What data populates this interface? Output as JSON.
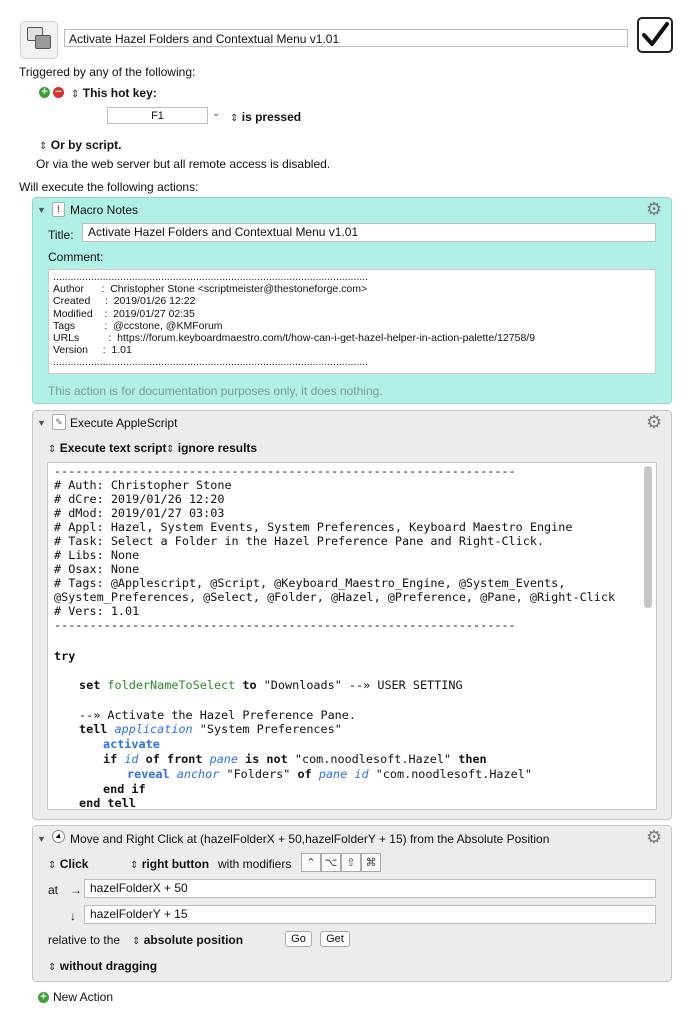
{
  "macro": {
    "name": "Activate Hazel Folders and Contextual Menu v1.01"
  },
  "triggers": {
    "heading": "Triggered by any of the following:",
    "hotkey_label": "This hot key:",
    "hotkey_value": "F1",
    "hotkey_state": "is pressed",
    "script_label": "Or by script.",
    "web_server_text": "Or via the web server but all remote access is disabled."
  },
  "actions_heading": "Will execute the following actions:",
  "notes_action": {
    "title": "Macro Notes",
    "title_label": "Title:",
    "title_value": "Activate Hazel Folders and Contextual Menu v1.01",
    "comment_label": "Comment:",
    "comment_text": "............................................................................................................\nAuthor      :  Christopher Stone <scriptmeister@thestoneforge.com>\nCreated     :  2019/01/26 12:22\nModified    :  2019/01/27 02:35\nTags          :  @ccstone, @KMForum\nURLs          :  https://forum.keyboardmaestro.com/t/how-can-i-get-hazel-helper-in-action-palette/12758/9\nVersion     :  1.01\n............................................................................................................",
    "footer": "This action is for documentation purposes only, it does nothing."
  },
  "applescript_action": {
    "title": "Execute AppleScript",
    "mode": "Execute text script",
    "results": "ignore results",
    "lines": [
      "-----------------------------------------------------------------",
      "# Auth: Christopher Stone",
      "# dCre: 2019/01/26 12:20",
      "# dMod: 2019/01/27 03:03",
      "# Appl: Hazel, System Events, System Preferences, Keyboard Maestro Engine",
      "# Task: Select a Folder in the Hazel Preference Pane and Right-Click.",
      "# Libs: None",
      "# Osax: None",
      "# Tags: @Applescript, @Script, @Keyboard_Maestro_Engine, @System_Events,",
      "@System_Preferences, @Select, @Folder, @Hazel, @Preference, @Pane, @Right-Click",
      "# Vers: 1.01",
      "-----------------------------------------------------------------"
    ],
    "code": {
      "try": "try",
      "set": "set",
      "var": "folderNameToSelect",
      "to": "to",
      "set_value": "\"Downloads\" --» USER SETTING",
      "comment": "--» Activate the Hazel Preference Pane.",
      "tell": "tell",
      "application": "application",
      "app_name": "\"System Preferences\"",
      "activate": "activate",
      "if": "if",
      "id": "id",
      "of_front": "of front",
      "pane": "pane",
      "is_not": "is not",
      "bundle_id": "\"com.noodlesoft.Hazel\"",
      "then": "then",
      "reveal": "reveal",
      "anchor": "anchor",
      "folders": "\"Folders\"",
      "of": "of",
      "end_if": "end if",
      "end_tell": "end tell"
    }
  },
  "move_click_action": {
    "title": "Move and Right Click at (hazelFolderX + 50,hazelFolderY + 15) from the Absolute Position",
    "click_label": "Click",
    "button_label": "right button",
    "modifiers_label": "with modifiers",
    "modifier_keys": [
      "⌃",
      "⌥",
      "⇧",
      "⌘"
    ],
    "at_label": "at",
    "arrow_right": "→",
    "arrow_down": "↓",
    "x_value": "hazelFolderX + 50",
    "y_value": "hazelFolderY + 15",
    "relative_label": "relative to the",
    "position_label": "absolute position",
    "go_button": "Go",
    "get_button": "Get",
    "drag_label": "without dragging"
  },
  "footer": {
    "new_action": "New Action"
  }
}
